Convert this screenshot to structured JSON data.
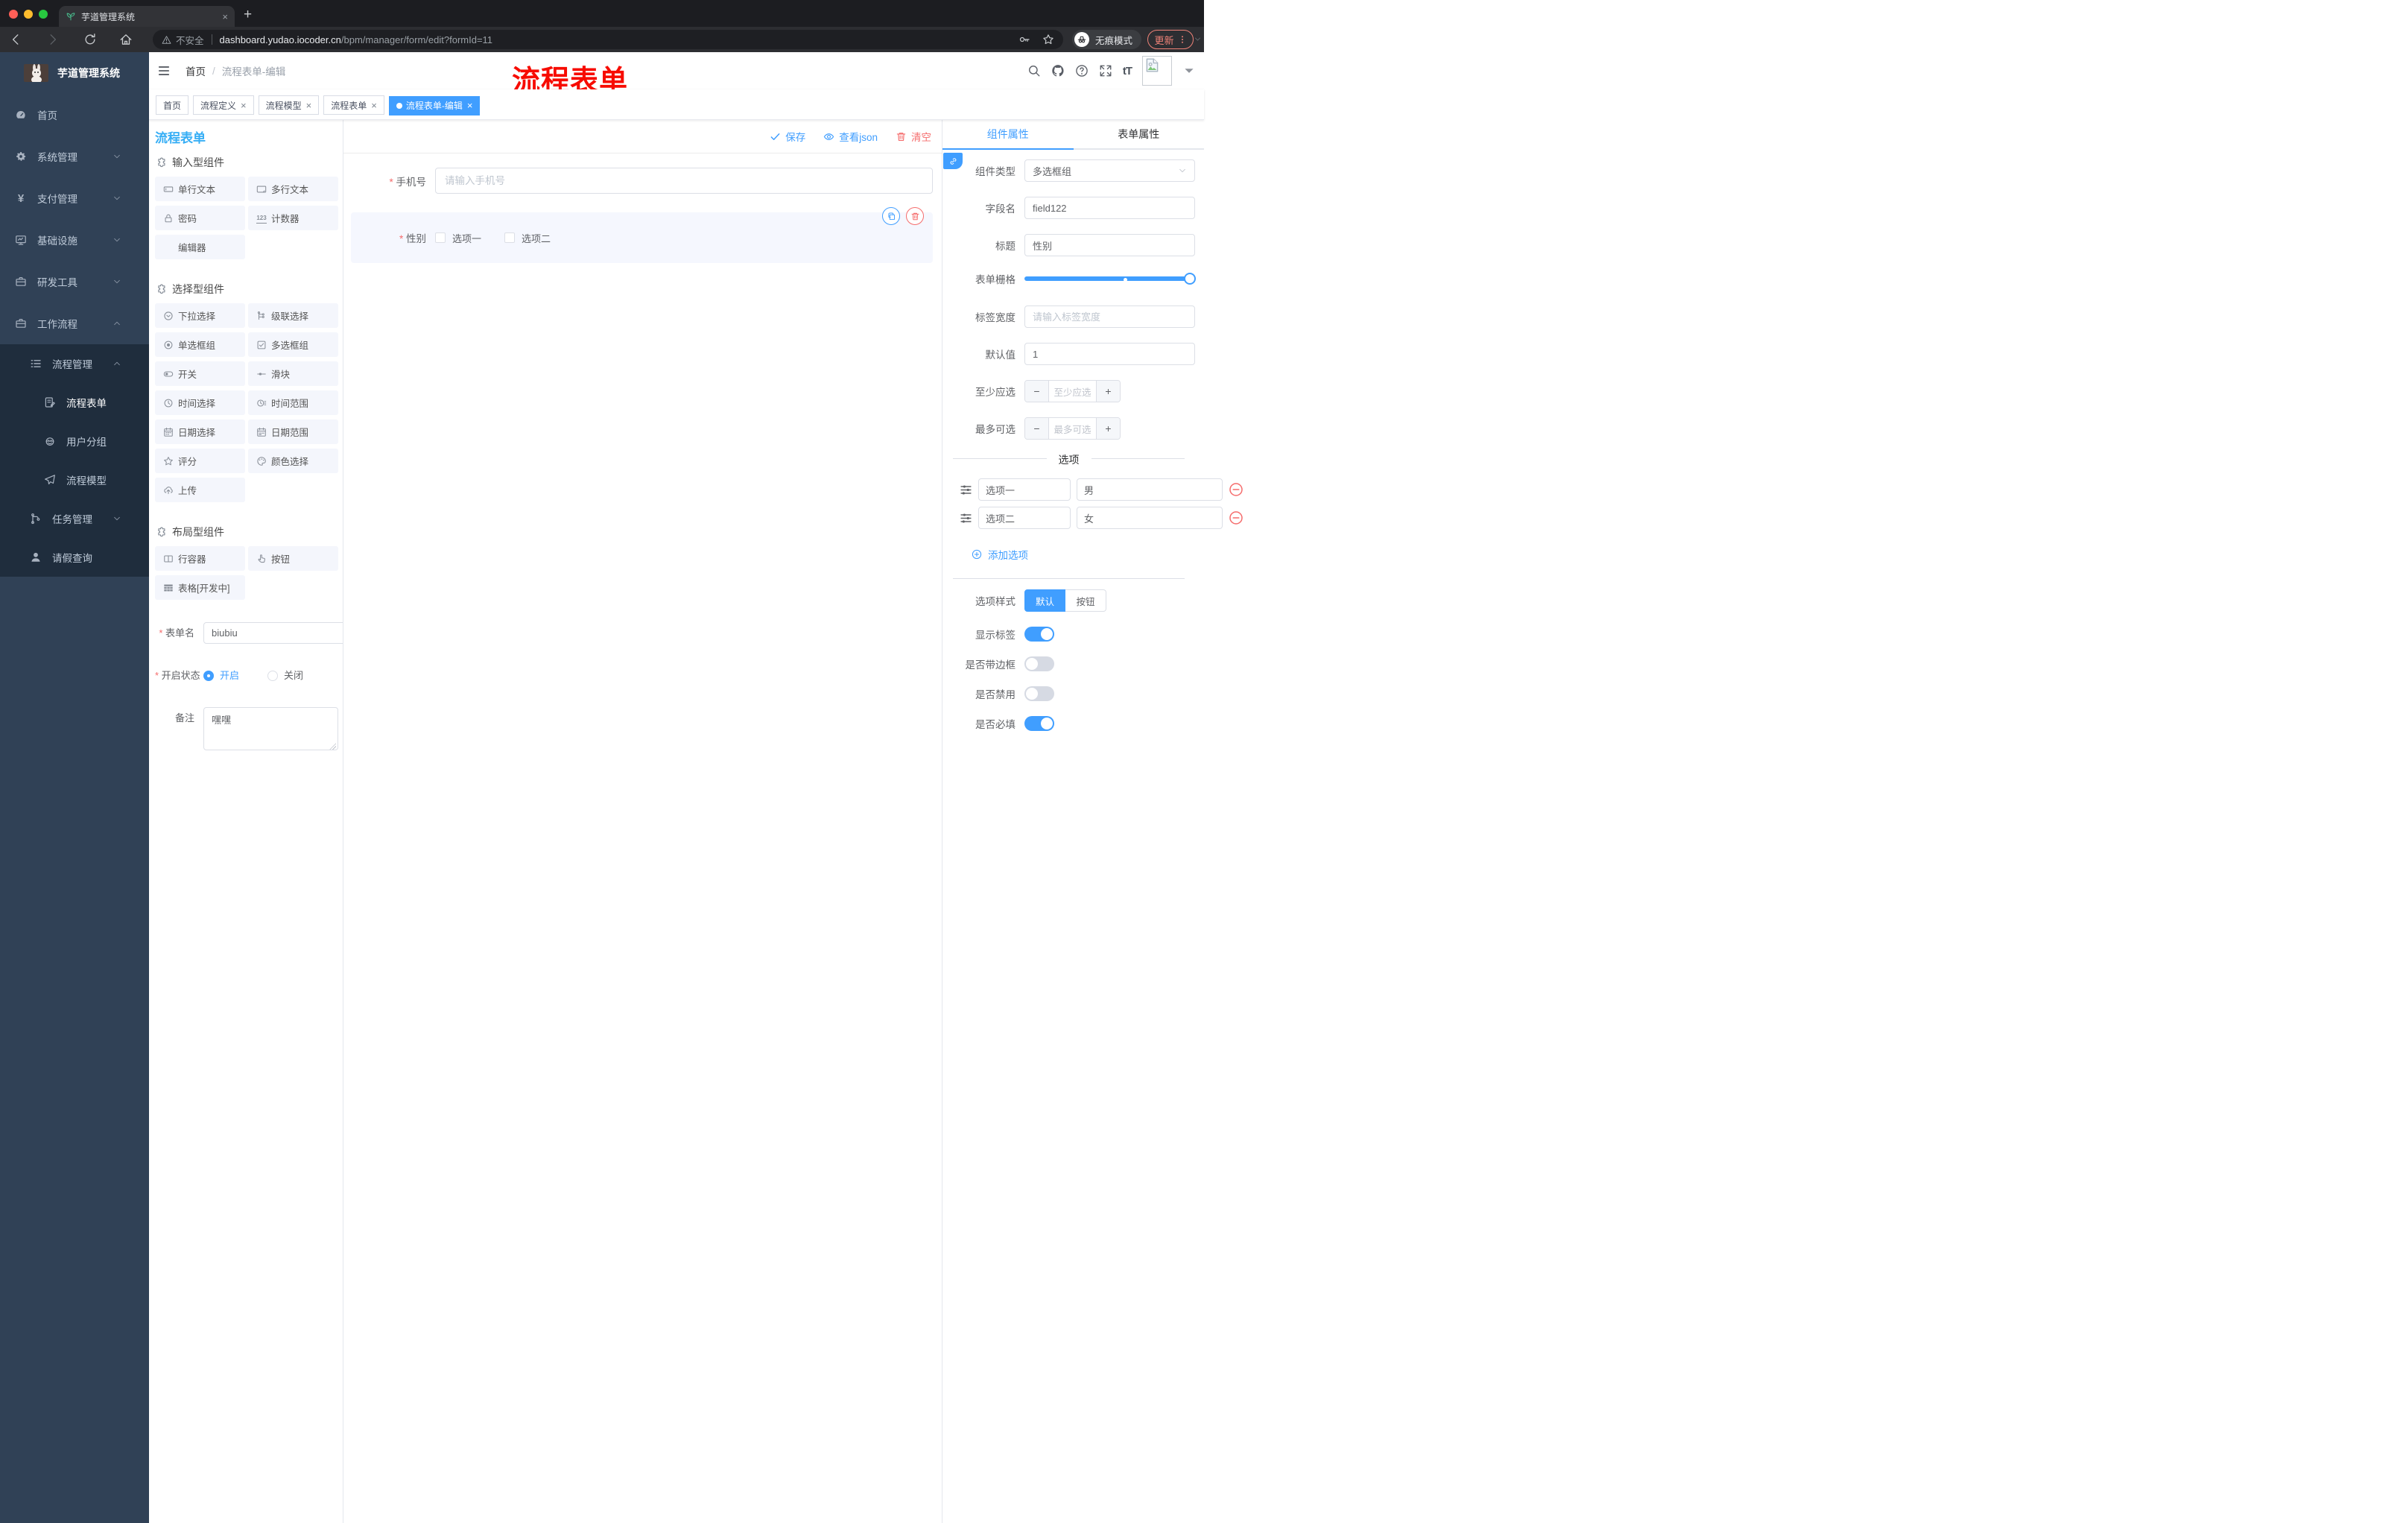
{
  "colors": {
    "primary": "#409EFF",
    "danger": "#F56C6C",
    "panel_title_blue": "#36AEF5",
    "watermark_red": "#F70B00",
    "sidebar_bg": "#304156",
    "submenu_bg": "#1F2D3D",
    "update_red": "#EE8277"
  },
  "browser": {
    "tab_title": "芋道管理系统",
    "new_tab": "+",
    "close_tab": "×",
    "security_label": "不安全",
    "url_domain": "dashboard.yudao.iocoder.cn",
    "url_path": "/bpm/manager/form/edit?formId=11",
    "incognito_label": "无痕模式",
    "update_label": "更新"
  },
  "sidebar": {
    "app_title": "芋道管理系统",
    "menu": [
      {
        "label": "首页",
        "icon": "dashboard",
        "level": 0,
        "arrow": ""
      },
      {
        "label": "系统管理",
        "icon": "gear",
        "level": 0,
        "arrow": "down"
      },
      {
        "label": "支付管理",
        "icon": "yen",
        "level": 0,
        "arrow": "down"
      },
      {
        "label": "基础设施",
        "icon": "monitor",
        "level": 0,
        "arrow": "down"
      },
      {
        "label": "研发工具",
        "icon": "briefcase",
        "level": 0,
        "arrow": "down"
      },
      {
        "label": "工作流程",
        "icon": "briefcase",
        "level": 0,
        "arrow": "up"
      },
      {
        "label": "流程管理",
        "icon": "listmgr",
        "level": 1,
        "arrow": "up",
        "sub": true
      },
      {
        "label": "流程表单",
        "icon": "docform",
        "level": 2,
        "sub": true,
        "active": true
      },
      {
        "label": "用户分组",
        "icon": "robot",
        "level": 2,
        "sub": true
      },
      {
        "label": "流程模型",
        "icon": "plane",
        "level": 2,
        "sub": true
      },
      {
        "label": "任务管理",
        "icon": "tree",
        "level": 1,
        "arrow": "down",
        "sub": true
      },
      {
        "label": "请假查询",
        "icon": "userfill",
        "level": 1,
        "sub": true
      }
    ]
  },
  "header": {
    "breadcrumb": [
      "首页",
      "流程表单-编辑"
    ],
    "breadcrumb_sep": "/",
    "watermark": "流程表单",
    "right_icons": [
      "search",
      "github",
      "question",
      "expand",
      "font-size"
    ]
  },
  "tags": [
    {
      "label": "首页",
      "closable": false,
      "active": false
    },
    {
      "label": "流程定义",
      "closable": true,
      "active": false
    },
    {
      "label": "流程模型",
      "closable": true,
      "active": false
    },
    {
      "label": "流程表单",
      "closable": true,
      "active": false
    },
    {
      "label": "流程表单-编辑",
      "closable": true,
      "active": true
    }
  ],
  "designer": {
    "panel_title": "流程表单",
    "toolbar": {
      "save": "保存",
      "view_json": "查看json",
      "clear": "清空"
    },
    "groups": [
      {
        "title": "输入型组件",
        "items": [
          {
            "label": "单行文本",
            "icon": "input"
          },
          {
            "label": "多行文本",
            "icon": "textarea"
          },
          {
            "label": "密码",
            "icon": "lock"
          },
          {
            "label": "计数器",
            "icon": "counter"
          },
          {
            "label": "编辑器",
            "icon": ""
          }
        ]
      },
      {
        "title": "选择型组件",
        "items": [
          {
            "label": "下拉选择",
            "icon": "select"
          },
          {
            "label": "级联选择",
            "icon": "cascader"
          },
          {
            "label": "单选框组",
            "icon": "radio"
          },
          {
            "label": "多选框组",
            "icon": "checkbox"
          },
          {
            "label": "开关",
            "icon": "switch"
          },
          {
            "label": "滑块",
            "icon": "slideric"
          },
          {
            "label": "时间选择",
            "icon": "time"
          },
          {
            "label": "时间范围",
            "icon": "timerange"
          },
          {
            "label": "日期选择",
            "icon": "date"
          },
          {
            "label": "日期范围",
            "icon": "daterange"
          },
          {
            "label": "评分",
            "icon": "star"
          },
          {
            "label": "颜色选择",
            "icon": "palette"
          },
          {
            "label": "上传",
            "icon": "upload"
          }
        ]
      },
      {
        "title": "布局型组件",
        "items": [
          {
            "label": "行容器",
            "icon": "columns"
          },
          {
            "label": "按钮",
            "icon": "hand"
          },
          {
            "label": "表格[开发中]",
            "icon": "tablegrid"
          }
        ]
      }
    ],
    "form": {
      "name_label": "表单名",
      "name_value": "biubiu",
      "status_label": "开启状态",
      "status_on": "开启",
      "status_off": "关闭",
      "remark_label": "备注",
      "remark_value": "嘿嘿"
    },
    "canvas": {
      "phone": {
        "label": "手机号",
        "placeholder": "请输入手机号",
        "required": true
      },
      "gender": {
        "label": "性别",
        "required": true,
        "options": [
          "选项一",
          "选项二"
        ],
        "selected": true
      }
    },
    "props": {
      "tabs": [
        "组件属性",
        "表单属性"
      ],
      "type_label": "组件类型",
      "type_value": "多选框组",
      "field_label": "字段名",
      "field_value": "field122",
      "title_label": "标题",
      "title_value": "性别",
      "grid_label": "表单栅格",
      "labelwidth_label": "标签宽度",
      "labelwidth_placeholder": "请输入标签宽度",
      "default_label": "默认值",
      "default_value": "1",
      "min_label": "至少应选",
      "min_placeholder": "至少应选",
      "max_label": "最多可选",
      "max_placeholder": "最多可选",
      "options_divider": "选项",
      "options": [
        {
          "value": "选项一",
          "text": "男"
        },
        {
          "value": "选项二",
          "text": "女"
        }
      ],
      "add_option": "添加选项",
      "style_label": "选项样式",
      "style_options": [
        "默认",
        "按钮"
      ],
      "style_active": 0,
      "toggles": [
        {
          "label": "显示标签",
          "on": true
        },
        {
          "label": "是否带边框",
          "on": false
        },
        {
          "label": "是否禁用",
          "on": false
        },
        {
          "label": "是否必填",
          "on": true
        }
      ]
    }
  }
}
